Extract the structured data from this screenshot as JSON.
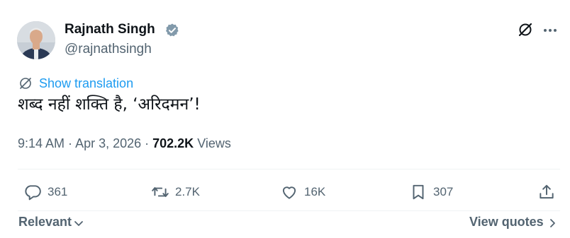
{
  "author": {
    "name": "Rajnath Singh",
    "handle": "@rajnathsingh",
    "verified_icon": "verified-badge-icon"
  },
  "header_icons": [
    "grok-icon",
    "more-icon"
  ],
  "translation": {
    "label": "Show translation",
    "icon": "translate-icon"
  },
  "tweet": {
    "text": "शब्द नहीं शक्ति है, ‘अरिदमन’!"
  },
  "meta": {
    "time": "9:14 AM",
    "separator": " · ",
    "date": "Apr 3, 2026",
    "views_count": "702.2K",
    "views_label": " Views"
  },
  "actions": {
    "replies": "361",
    "reposts": "2.7K",
    "likes": "16K",
    "bookmarks": "307"
  },
  "footer": {
    "sort_label": "Relevant",
    "quotes_label": "View quotes"
  },
  "colors": {
    "accent": "#1d9bf0",
    "text_primary": "#0f1419",
    "text_secondary": "#536471",
    "divider": "#eff3f4"
  }
}
